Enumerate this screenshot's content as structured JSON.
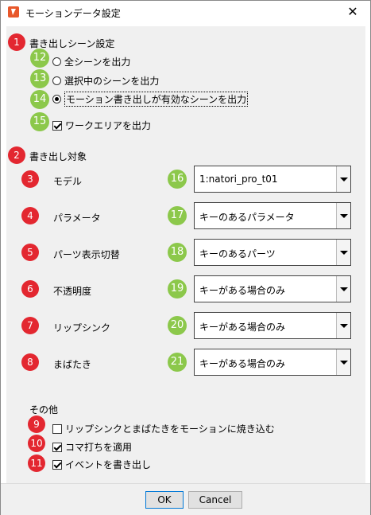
{
  "window": {
    "title": "モーションデータ設定",
    "close_glyph": "✕"
  },
  "export_scene": {
    "heading": "書き出しシーン設定",
    "options": [
      {
        "label": "全シーンを出力",
        "selected": false
      },
      {
        "label": "選択中のシーンを出力",
        "selected": false
      },
      {
        "label": "モーション書き出しが有効なシーンを出力",
        "selected": true
      }
    ],
    "work_area": {
      "label": "ワークエリアを出力",
      "checked": true
    }
  },
  "export_target": {
    "heading": "書き出し対象",
    "rows": [
      {
        "label": "モデル",
        "value": "1:natori_pro_t01"
      },
      {
        "label": "パラメータ",
        "value": "キーのあるパラメータ"
      },
      {
        "label": "パーツ表示切替",
        "value": "キーのあるパーツ"
      },
      {
        "label": "不透明度",
        "value": "キーがある場合のみ"
      },
      {
        "label": "リップシンク",
        "value": "キーがある場合のみ"
      },
      {
        "label": "まばたき",
        "value": "キーがある場合のみ"
      }
    ]
  },
  "other": {
    "heading": "その他",
    "checks": [
      {
        "label": "リップシンクとまばたきをモーションに焼き込む",
        "checked": false
      },
      {
        "label": "コマ打ちを適用",
        "checked": true
      },
      {
        "label": "イベントを書き出し",
        "checked": true
      }
    ]
  },
  "badges": {
    "red": [
      "1",
      "2",
      "3",
      "4",
      "5",
      "6",
      "7",
      "8",
      "9",
      "10",
      "11"
    ],
    "green": [
      "12",
      "13",
      "14",
      "15",
      "16",
      "17",
      "18",
      "19",
      "20",
      "21"
    ]
  },
  "buttons": {
    "ok": "OK",
    "cancel": "Cancel"
  },
  "colors": {
    "badge_red": "#e32730",
    "badge_green": "#8cc84b",
    "app_icon": "#e8582b"
  }
}
